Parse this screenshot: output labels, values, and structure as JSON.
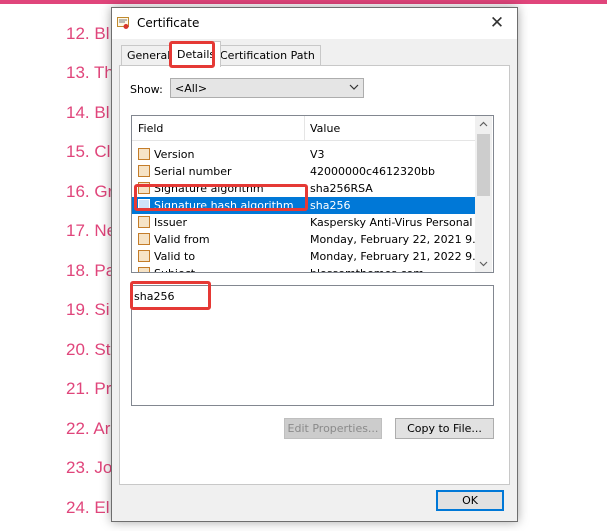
{
  "background_list": [
    "12. Bl",
    "13. Th",
    "14. Bl",
    "15. Cl",
    "16. Gr",
    "17. Ne",
    "18. Pa",
    "19. Si",
    "20. St",
    "21. Pr",
    "22. Ar",
    "23. Jo",
    "24. El"
  ],
  "dialog": {
    "title": "Certificate",
    "close_glyph": "✕",
    "tabs": [
      "General",
      "Details",
      "Certification Path"
    ],
    "active_tab": "Details",
    "show_label": "Show:",
    "show_value": "<All>",
    "columns": {
      "field": "Field",
      "value": "Value"
    },
    "rows": [
      {
        "field": "Version",
        "value": "V3"
      },
      {
        "field": "Serial number",
        "value": "42000000c4612320bb"
      },
      {
        "field": "Signature algorithm",
        "value": "sha256RSA"
      },
      {
        "field": "Signature hash algorithm",
        "value": "sha256",
        "selected": true
      },
      {
        "field": "Issuer",
        "value": "Kaspersky Anti-Virus Personal ..."
      },
      {
        "field": "Valid from",
        "value": "Monday, February 22, 2021 9..."
      },
      {
        "field": "Valid to",
        "value": "Monday, February 21, 2022 9..."
      },
      {
        "field": "Subject",
        "value": "blossomthemes.com"
      }
    ],
    "detail_value": "sha256",
    "buttons": {
      "edit_properties": "Edit Properties...",
      "copy_to_file": "Copy to File...",
      "ok": "OK"
    }
  },
  "colors": {
    "accent_pink": "#e0457b",
    "selection_blue": "#0078d7",
    "highlight_red": "#e53935"
  }
}
